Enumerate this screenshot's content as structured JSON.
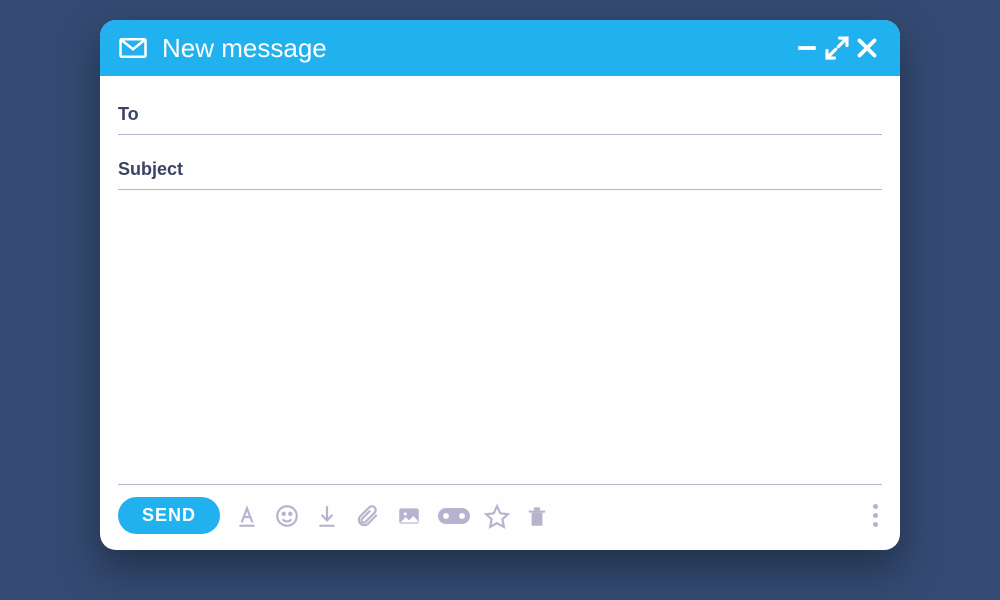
{
  "header": {
    "title": "New message"
  },
  "fields": {
    "to_label": "To",
    "to_value": "",
    "subject_label": "Subject",
    "subject_value": ""
  },
  "body": {
    "value": ""
  },
  "footer": {
    "send_label": "SEND"
  },
  "icons": {
    "envelope": "envelope-icon",
    "minimize": "minimize-icon",
    "expand": "expand-icon",
    "close": "close-icon",
    "text_format": "text-format-icon",
    "emoji": "emoji-icon",
    "download": "download-icon",
    "attachment": "paperclip-icon",
    "image": "image-icon",
    "link": "link-icon",
    "star": "star-icon",
    "trash": "trash-icon",
    "more": "more-icon"
  },
  "colors": {
    "accent": "#22b1ef",
    "background": "#344a72",
    "muted": "#b6b3ce",
    "text": "#3c4263"
  }
}
